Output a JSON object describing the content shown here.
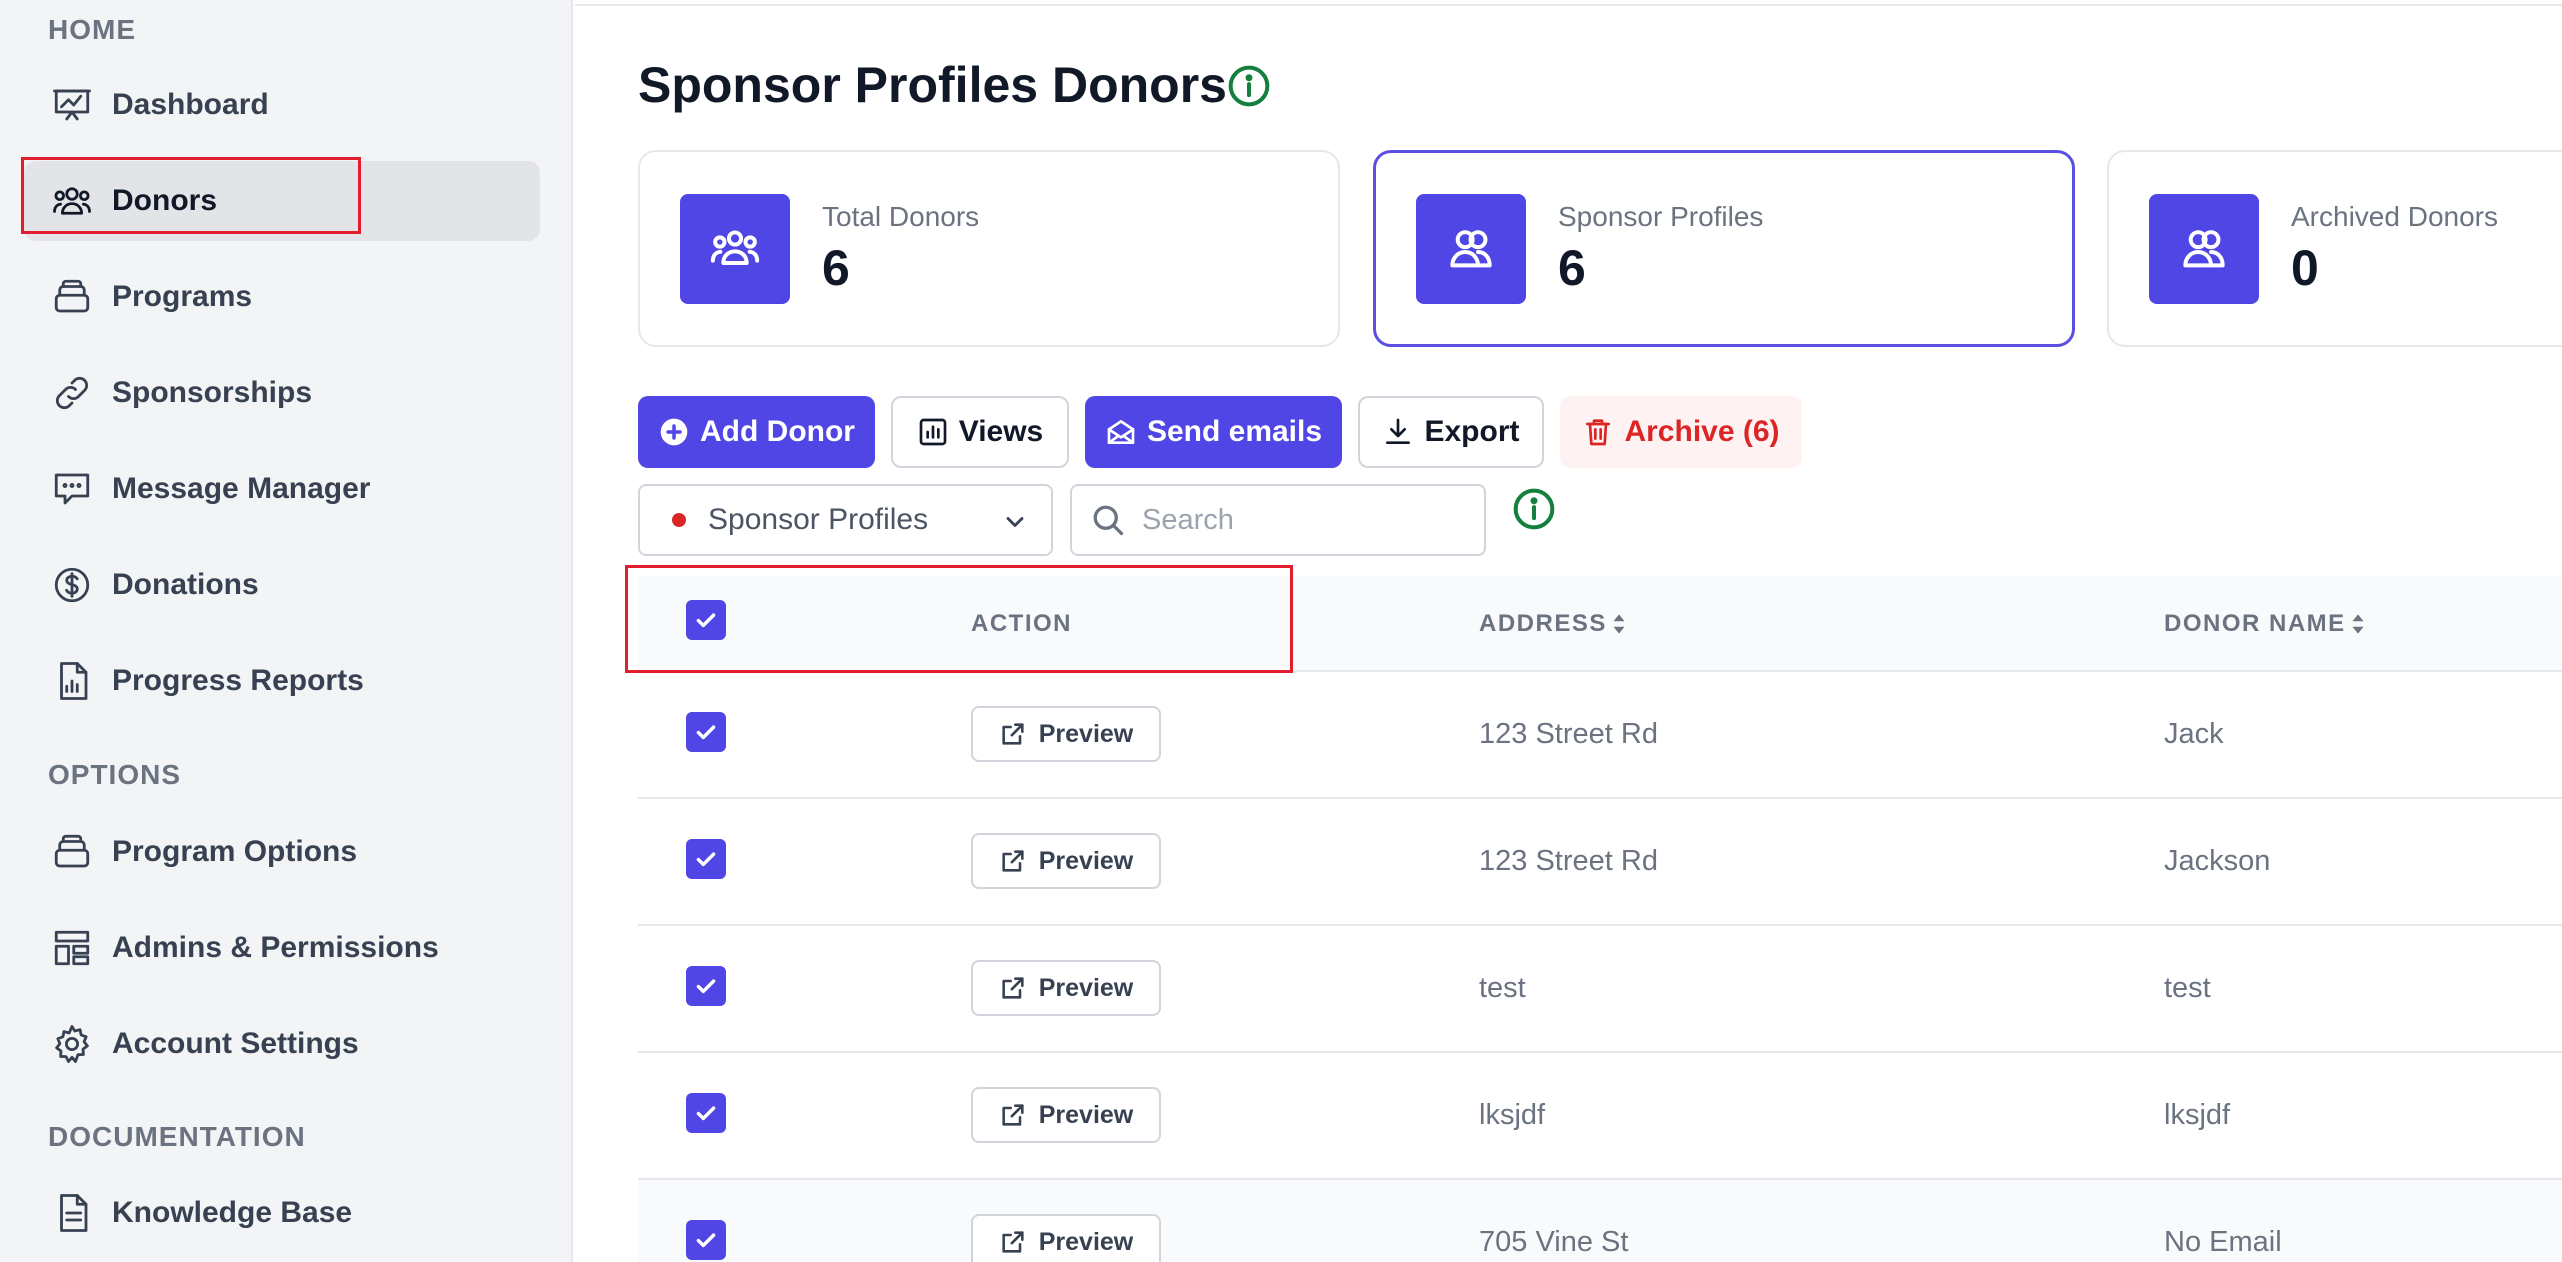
{
  "sidebar": {
    "sections": [
      {
        "label": "HOME"
      },
      {
        "label": "OPTIONS"
      },
      {
        "label": "DOCUMENTATION"
      }
    ],
    "items": [
      {
        "label": "Dashboard",
        "icon": "chart-presentation-icon"
      },
      {
        "label": "Donors",
        "icon": "users-icon",
        "active": true
      },
      {
        "label": "Programs",
        "icon": "layers-icon"
      },
      {
        "label": "Sponsorships",
        "icon": "link-icon"
      },
      {
        "label": "Message Manager",
        "icon": "message-icon"
      },
      {
        "label": "Donations",
        "icon": "dollar-circle-icon"
      },
      {
        "label": "Progress Reports",
        "icon": "report-icon"
      },
      {
        "label": "Program Options",
        "icon": "layers-icon"
      },
      {
        "label": "Admins & Permissions",
        "icon": "layout-icon"
      },
      {
        "label": "Account Settings",
        "icon": "gear-icon"
      },
      {
        "label": "Knowledge Base",
        "icon": "document-icon"
      }
    ]
  },
  "header": {
    "title": "Sponsor Profiles Donors"
  },
  "stats": [
    {
      "label": "Total Donors",
      "value": "6"
    },
    {
      "label": "Sponsor Profiles",
      "value": "6",
      "selected": true
    },
    {
      "label": "Archived Donors",
      "value": "0"
    }
  ],
  "toolbar": {
    "add_label": "Add Donor",
    "views_label": "Views",
    "send_label": "Send emails",
    "export_label": "Export",
    "archive_label": "Archive (6)"
  },
  "filter": {
    "selected": "Sponsor Profiles",
    "search_placeholder": "Search"
  },
  "table": {
    "columns": [
      "ACTION",
      "ADDRESS",
      "DONOR NAME"
    ],
    "preview_label": "Preview",
    "rows": [
      {
        "address": "123 Street Rd",
        "donor_name": "Jack"
      },
      {
        "address": "123 Street Rd",
        "donor_name": "Jackson"
      },
      {
        "address": "test",
        "donor_name": "test"
      },
      {
        "address": "lksjdf",
        "donor_name": "lksjdf"
      },
      {
        "address": "705 Vine St",
        "donor_name": "No Email"
      }
    ]
  },
  "colors": {
    "accent": "#4f46e5",
    "danger": "#dc2626",
    "info": "#15803d",
    "annotation": "#e11d2e"
  }
}
